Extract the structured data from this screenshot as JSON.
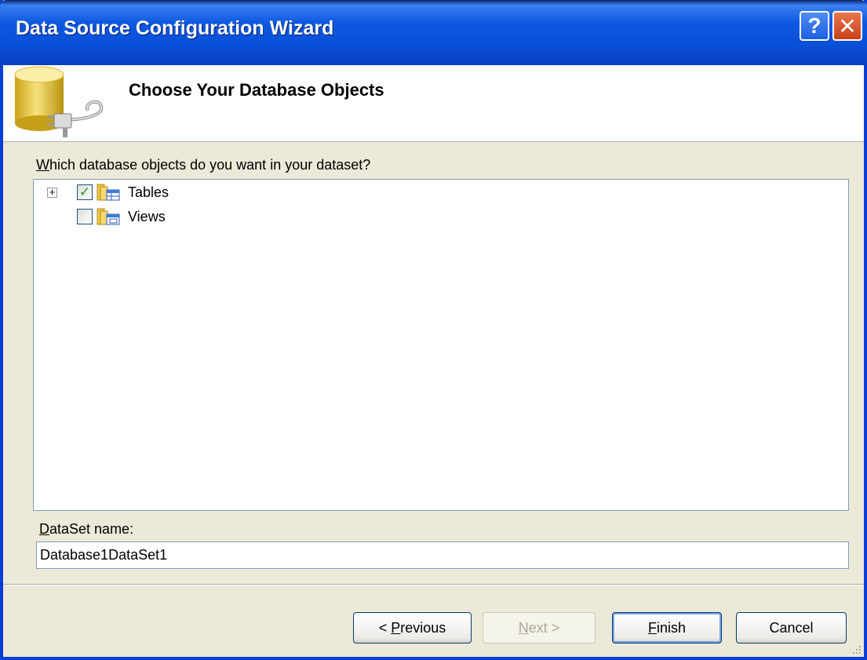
{
  "window": {
    "title": "Data Source Configuration Wizard",
    "help_label": "?",
    "close_label": "✕"
  },
  "header": {
    "title": "Choose Your Database Objects",
    "icon": "database-plug-icon"
  },
  "objects": {
    "prompt_prefix": "",
    "prompt_accel": "W",
    "prompt_rest": "hich database objects do you want in your dataset?",
    "items": [
      {
        "label": "Tables",
        "checked": true,
        "expander": "+",
        "icon": "tables-icon"
      },
      {
        "label": "Views",
        "checked": false,
        "icon": "views-icon"
      }
    ]
  },
  "dataset": {
    "label_accel": "D",
    "label_rest": "ataSet name:",
    "value": "Database1DataSet1"
  },
  "buttons": {
    "previous_prefix": "< ",
    "previous_accel": "P",
    "previous_rest": "revious",
    "next_accel": "N",
    "next_rest": "ext >",
    "finish_accel": "F",
    "finish_rest": "inish",
    "cancel": "Cancel"
  },
  "colors": {
    "titlebar": "#0a50d8",
    "dialog_bg": "#ece9d8",
    "check_mark": "#21a121"
  }
}
